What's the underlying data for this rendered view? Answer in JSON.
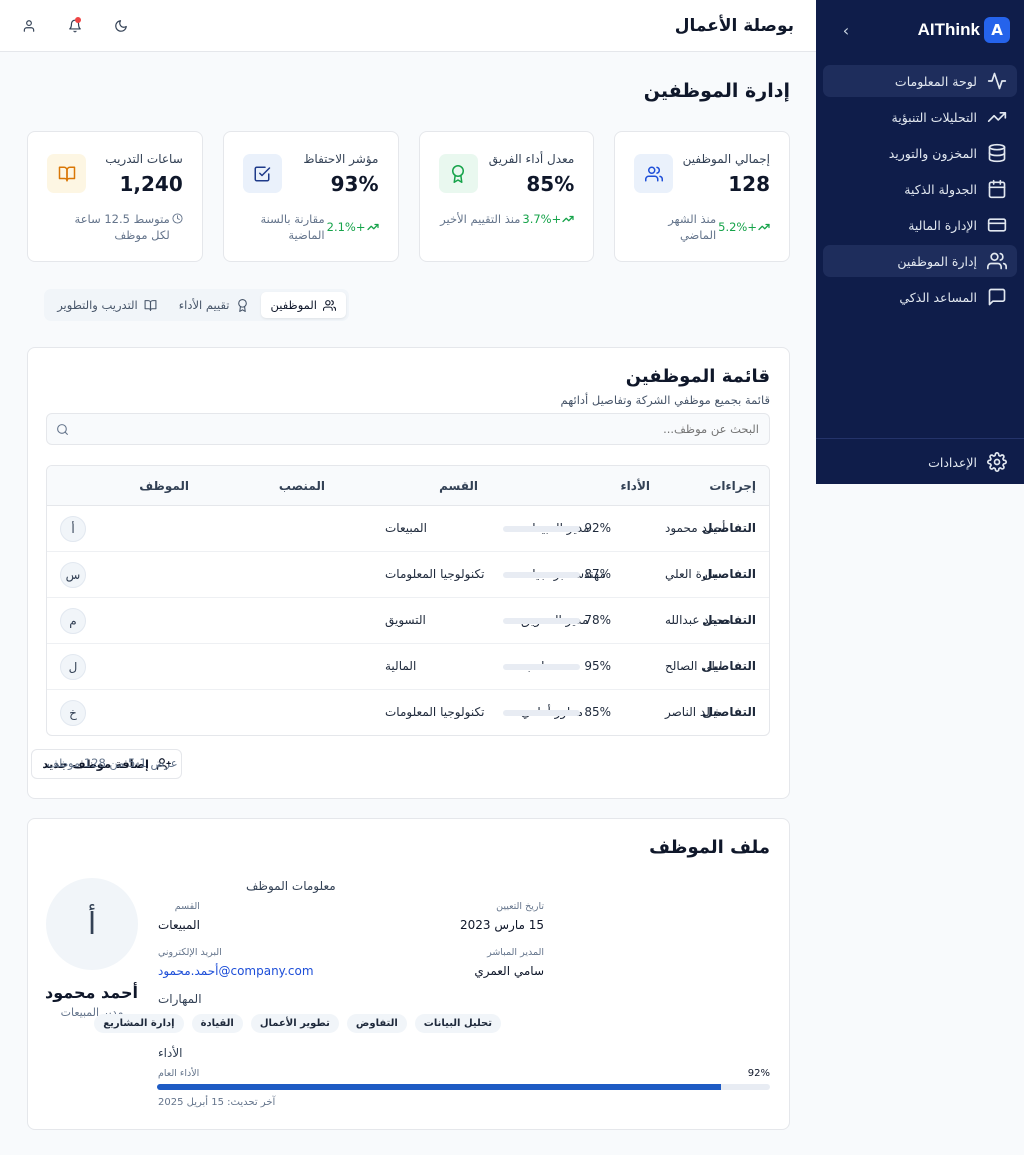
{
  "sidebar": {
    "brand": "AIThink",
    "brand_letter": "A",
    "collapse": "›",
    "items": [
      {
        "label": "لوحة المعلومات",
        "icon": "activity-icon"
      },
      {
        "label": "التحليلات التنبؤية",
        "icon": "trending-up-icon"
      },
      {
        "label": "المخزون والتوريد",
        "icon": "database-icon"
      },
      {
        "label": "الجدولة الذكية",
        "icon": "calendar-icon"
      },
      {
        "label": "الإدارة المالية",
        "icon": "credit-card-icon"
      },
      {
        "label": "إدارة الموظفين",
        "icon": "users-icon"
      },
      {
        "label": "المساعد الذكي",
        "icon": "message-square-icon"
      }
    ],
    "settings": "الإعدادات"
  },
  "topbar": {
    "title": "بوصلة الأعمال"
  },
  "page_title": "إدارة الموظفين",
  "kpis": [
    {
      "label": "إجمالي الموظفين",
      "value": "128",
      "delta": "+5.2%",
      "note": "منذ الشهر الماضي",
      "icon": "users-icon",
      "icon_bg": "#eaf1fb",
      "icon_color": "#1d4ed8"
    },
    {
      "label": "معدل أداء الفريق",
      "value": "85%",
      "delta": "+3.7%",
      "note": "منذ التقييم الأخير",
      "icon": "award-icon",
      "icon_bg": "#e9f8ef",
      "icon_color": "#16a34a"
    },
    {
      "label": "مؤشر الاحتفاظ",
      "value": "93%",
      "delta": "+2.1%",
      "note": "مقارنة بالسنة الماضية",
      "icon": "check-square-icon",
      "icon_bg": "#eaf1fb",
      "icon_color": "#1e3a8a"
    },
    {
      "label": "ساعات التدريب",
      "value": "1,240",
      "delta": "",
      "note": "متوسط 12.5 ساعة لكل موظف",
      "icon": "book-open-icon",
      "icon_bg": "#fdf6e3",
      "icon_color": "#d97706"
    }
  ],
  "tabs": [
    {
      "label": "الموظفين",
      "icon": "users-icon"
    },
    {
      "label": "تقييم الأداء",
      "icon": "award-icon"
    },
    {
      "label": "التدريب والتطوير",
      "icon": "book-open-icon"
    }
  ],
  "list": {
    "title": "قائمة الموظفين",
    "subtitle": "قائمة بجميع موظفي الشركة وتفاصيل أدائهم",
    "search_placeholder": "البحث عن موظف...",
    "columns": {
      "employee": "الموظف",
      "position": "المنصب",
      "department": "القسم",
      "performance": "الأداء",
      "actions": "إجراءات"
    },
    "rows": [
      {
        "initial": "أ",
        "name": "أحمد محمود",
        "position": "مدير المبيعات",
        "department": "المبيعات",
        "performance": 92,
        "performance_label": "92%",
        "action": "التفاصيل"
      },
      {
        "initial": "س",
        "name": "سارة العلي",
        "position": "مهندسة برمجيات",
        "department": "تكنولوجيا المعلومات",
        "performance": 87,
        "performance_label": "87%",
        "action": "التفاصيل"
      },
      {
        "initial": "م",
        "name": "محمد عبدالله",
        "position": "مدير التسويق",
        "department": "التسويق",
        "performance": 78,
        "performance_label": "78%",
        "action": "التفاصيل"
      },
      {
        "initial": "ل",
        "name": "ليلى الصالح",
        "position": "محاسبة",
        "department": "المالية",
        "performance": 95,
        "performance_label": "95%",
        "action": "التفاصيل"
      },
      {
        "initial": "خ",
        "name": "خالد الناصر",
        "position": "مطور أمامي",
        "department": "تكنولوجيا المعلومات",
        "performance": 85,
        "performance_label": "85%",
        "action": "التفاصيل"
      }
    ],
    "add_button": "إضافة موظف جديد",
    "count": "عرض 1-5 من 128 موظف"
  },
  "profile": {
    "title": "ملف الموظف",
    "initial": "أ",
    "name": "أحمد محمود",
    "role": "مدير المبيعات",
    "info_heading": "معلومات الموظف",
    "hire_date_label": "تاريخ التعيين",
    "hire_date": "15 مارس 2023",
    "department_label": "القسم",
    "department": "المبيعات",
    "manager_label": "المدير المباشر",
    "manager": "سامي العمري",
    "email_label": "البريد الإلكتروني",
    "email": "أحمد.محمود@company.com",
    "skills_heading": "المهارات",
    "skills": [
      "تحليل البيانات",
      "التفاوض",
      "تطوير الأعمال",
      "القيادة",
      "إدارة المشاريع"
    ],
    "performance_heading": "الأداء",
    "overall_label": "الأداء العام",
    "overall": 92,
    "overall_label_value": "92%",
    "last_update": "آخر تحديث: 15 أبريل 2025"
  }
}
